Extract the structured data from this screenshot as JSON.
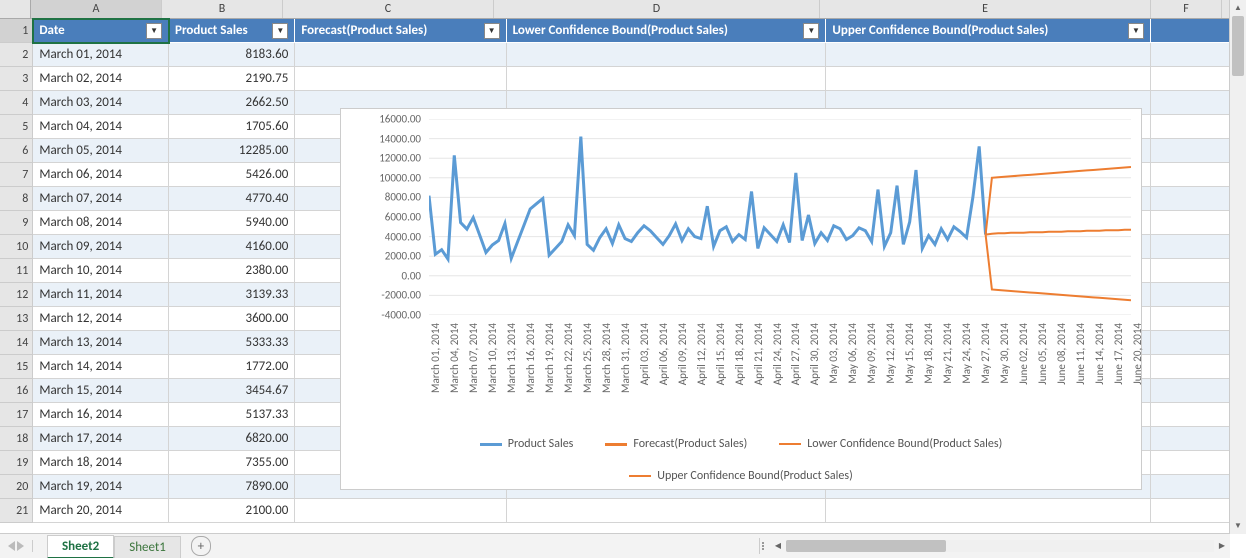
{
  "columns": [
    {
      "letter": "A",
      "label": "Date",
      "width": "col-A"
    },
    {
      "letter": "B",
      "label": "Product Sales",
      "width": "col-B"
    },
    {
      "letter": "C",
      "label": "Forecast(Product Sales)",
      "width": "col-C"
    },
    {
      "letter": "D",
      "label": "Lower Confidence Bound(Product Sales)",
      "width": "col-D"
    },
    {
      "letter": "E",
      "label": "Upper Confidence Bound(Product Sales)",
      "width": "col-E"
    },
    {
      "letter": "F",
      "label": "",
      "width": "col-F"
    }
  ],
  "rows": [
    {
      "n": 2,
      "date": "March 01, 2014",
      "val": "8183.60"
    },
    {
      "n": 3,
      "date": "March 02, 2014",
      "val": "2190.75"
    },
    {
      "n": 4,
      "date": "March 03, 2014",
      "val": "2662.50"
    },
    {
      "n": 5,
      "date": "March 04, 2014",
      "val": "1705.60"
    },
    {
      "n": 6,
      "date": "March 05, 2014",
      "val": "12285.00"
    },
    {
      "n": 7,
      "date": "March 06, 2014",
      "val": "5426.00"
    },
    {
      "n": 8,
      "date": "March 07, 2014",
      "val": "4770.40"
    },
    {
      "n": 9,
      "date": "March 08, 2014",
      "val": "5940.00"
    },
    {
      "n": 10,
      "date": "March 09, 2014",
      "val": "4160.00"
    },
    {
      "n": 11,
      "date": "March 10, 2014",
      "val": "2380.00"
    },
    {
      "n": 12,
      "date": "March 11, 2014",
      "val": "3139.33"
    },
    {
      "n": 13,
      "date": "March 12, 2014",
      "val": "3600.00"
    },
    {
      "n": 14,
      "date": "March 13, 2014",
      "val": "5333.33"
    },
    {
      "n": 15,
      "date": "March 14, 2014",
      "val": "1772.00"
    },
    {
      "n": 16,
      "date": "March 15, 2014",
      "val": "3454.67"
    },
    {
      "n": 17,
      "date": "March 16, 2014",
      "val": "5137.33"
    },
    {
      "n": 18,
      "date": "March 17, 2014",
      "val": "6820.00"
    },
    {
      "n": 19,
      "date": "March 18, 2014",
      "val": "7355.00"
    },
    {
      "n": 20,
      "date": "March 19, 2014",
      "val": "7890.00"
    },
    {
      "n": 21,
      "date": "March 20, 2014",
      "val": "2100.00"
    }
  ],
  "tabs": {
    "active": "Sheet2",
    "other": "Sheet1"
  },
  "chart_data": {
    "type": "line",
    "ylim": [
      -4000,
      16000
    ],
    "yticks": [
      "16000.00",
      "14000.00",
      "12000.00",
      "10000.00",
      "8000.00",
      "6000.00",
      "4000.00",
      "2000.00",
      "0.00",
      "-2000.00",
      "-4000.00"
    ],
    "x_dates": [
      "March 01, 2014",
      "March 04, 2014",
      "March 07, 2014",
      "March 10, 2014",
      "March 13, 2014",
      "March 16, 2014",
      "March 19, 2014",
      "March 22, 2014",
      "March 25, 2014",
      "March 28, 2014",
      "March 31, 2014",
      "April 03, 2014",
      "April 06, 2014",
      "April 09, 2014",
      "April 12, 2014",
      "April 15, 2014",
      "April 18, 2014",
      "April 21, 2014",
      "April 24, 2014",
      "April 27, 2014",
      "April 30, 2014",
      "May 03, 2014",
      "May 06, 2014",
      "May 09, 2014",
      "May 12, 2014",
      "May 15, 2014",
      "May 18, 2014",
      "May 21, 2014",
      "May 24, 2014",
      "May 27, 2014",
      "May 30, 2014",
      "June 02, 2014",
      "June 05, 2014",
      "June 08, 2014",
      "June 11, 2014",
      "June 14, 2014",
      "June 17, 2014",
      "June 20, 2014"
    ],
    "legend": [
      {
        "name": "Product Sales",
        "color": "blue",
        "thick": true
      },
      {
        "name": "Forecast(Product Sales)",
        "color": "orange",
        "thick": true
      },
      {
        "name": "Lower Confidence Bound(Product Sales)",
        "color": "orange",
        "thick": false
      },
      {
        "name": "Upper Confidence Bound(Product Sales)",
        "color": "orange",
        "thick": false
      }
    ],
    "series_product_sales": [
      8183.6,
      2190.75,
      2662.5,
      1705.6,
      12285.0,
      5426.0,
      4770.4,
      5940.0,
      4160.0,
      2380.0,
      3139.33,
      3600.0,
      5333.33,
      1772.0,
      3454.67,
      5137.33,
      6820.0,
      7355.0,
      7890.0,
      2100.0,
      2800,
      3500,
      5200,
      4100,
      14200,
      3200,
      2600,
      3900,
      4800,
      3300,
      5200,
      3800,
      3500,
      4400,
      5100,
      4600,
      3900,
      3200,
      4100,
      5300,
      3600,
      4800,
      4000,
      3800,
      7100,
      3000,
      4600,
      5000,
      3500,
      4200,
      3700,
      8600,
      2800,
      4900,
      4200,
      3500,
      5200,
      3400,
      10500,
      3600,
      6200,
      3300,
      4400,
      3600,
      5100,
      4800,
      3700,
      4100,
      4900,
      4600,
      3500,
      8800,
      3000,
      4400,
      9200,
      3200,
      5500,
      10800,
      2800,
      4100,
      3200,
      4800,
      3700,
      5000,
      4500,
      3900,
      8000,
      13200,
      4200
    ],
    "forecast_start_index": 88,
    "series_forecast": [
      4200,
      4300,
      4350,
      4350,
      4400,
      4400,
      4400,
      4450,
      4450,
      4450,
      4500,
      4500,
      4500,
      4550,
      4550,
      4550,
      4600,
      4600,
      4600,
      4650,
      4650,
      4650,
      4700,
      4700
    ],
    "series_lower": [
      4200,
      -1400,
      -1450,
      -1500,
      -1550,
      -1600,
      -1650,
      -1700,
      -1750,
      -1800,
      -1850,
      -1900,
      -1950,
      -2000,
      -2050,
      -2100,
      -2150,
      -2200,
      -2250,
      -2300,
      -2350,
      -2400,
      -2450,
      -2500
    ],
    "series_upper": [
      4200,
      10000,
      10050,
      10100,
      10150,
      10200,
      10250,
      10300,
      10350,
      10400,
      10450,
      10500,
      10550,
      10600,
      10650,
      10700,
      10750,
      10800,
      10850,
      10900,
      10950,
      11000,
      11050,
      11100
    ]
  }
}
